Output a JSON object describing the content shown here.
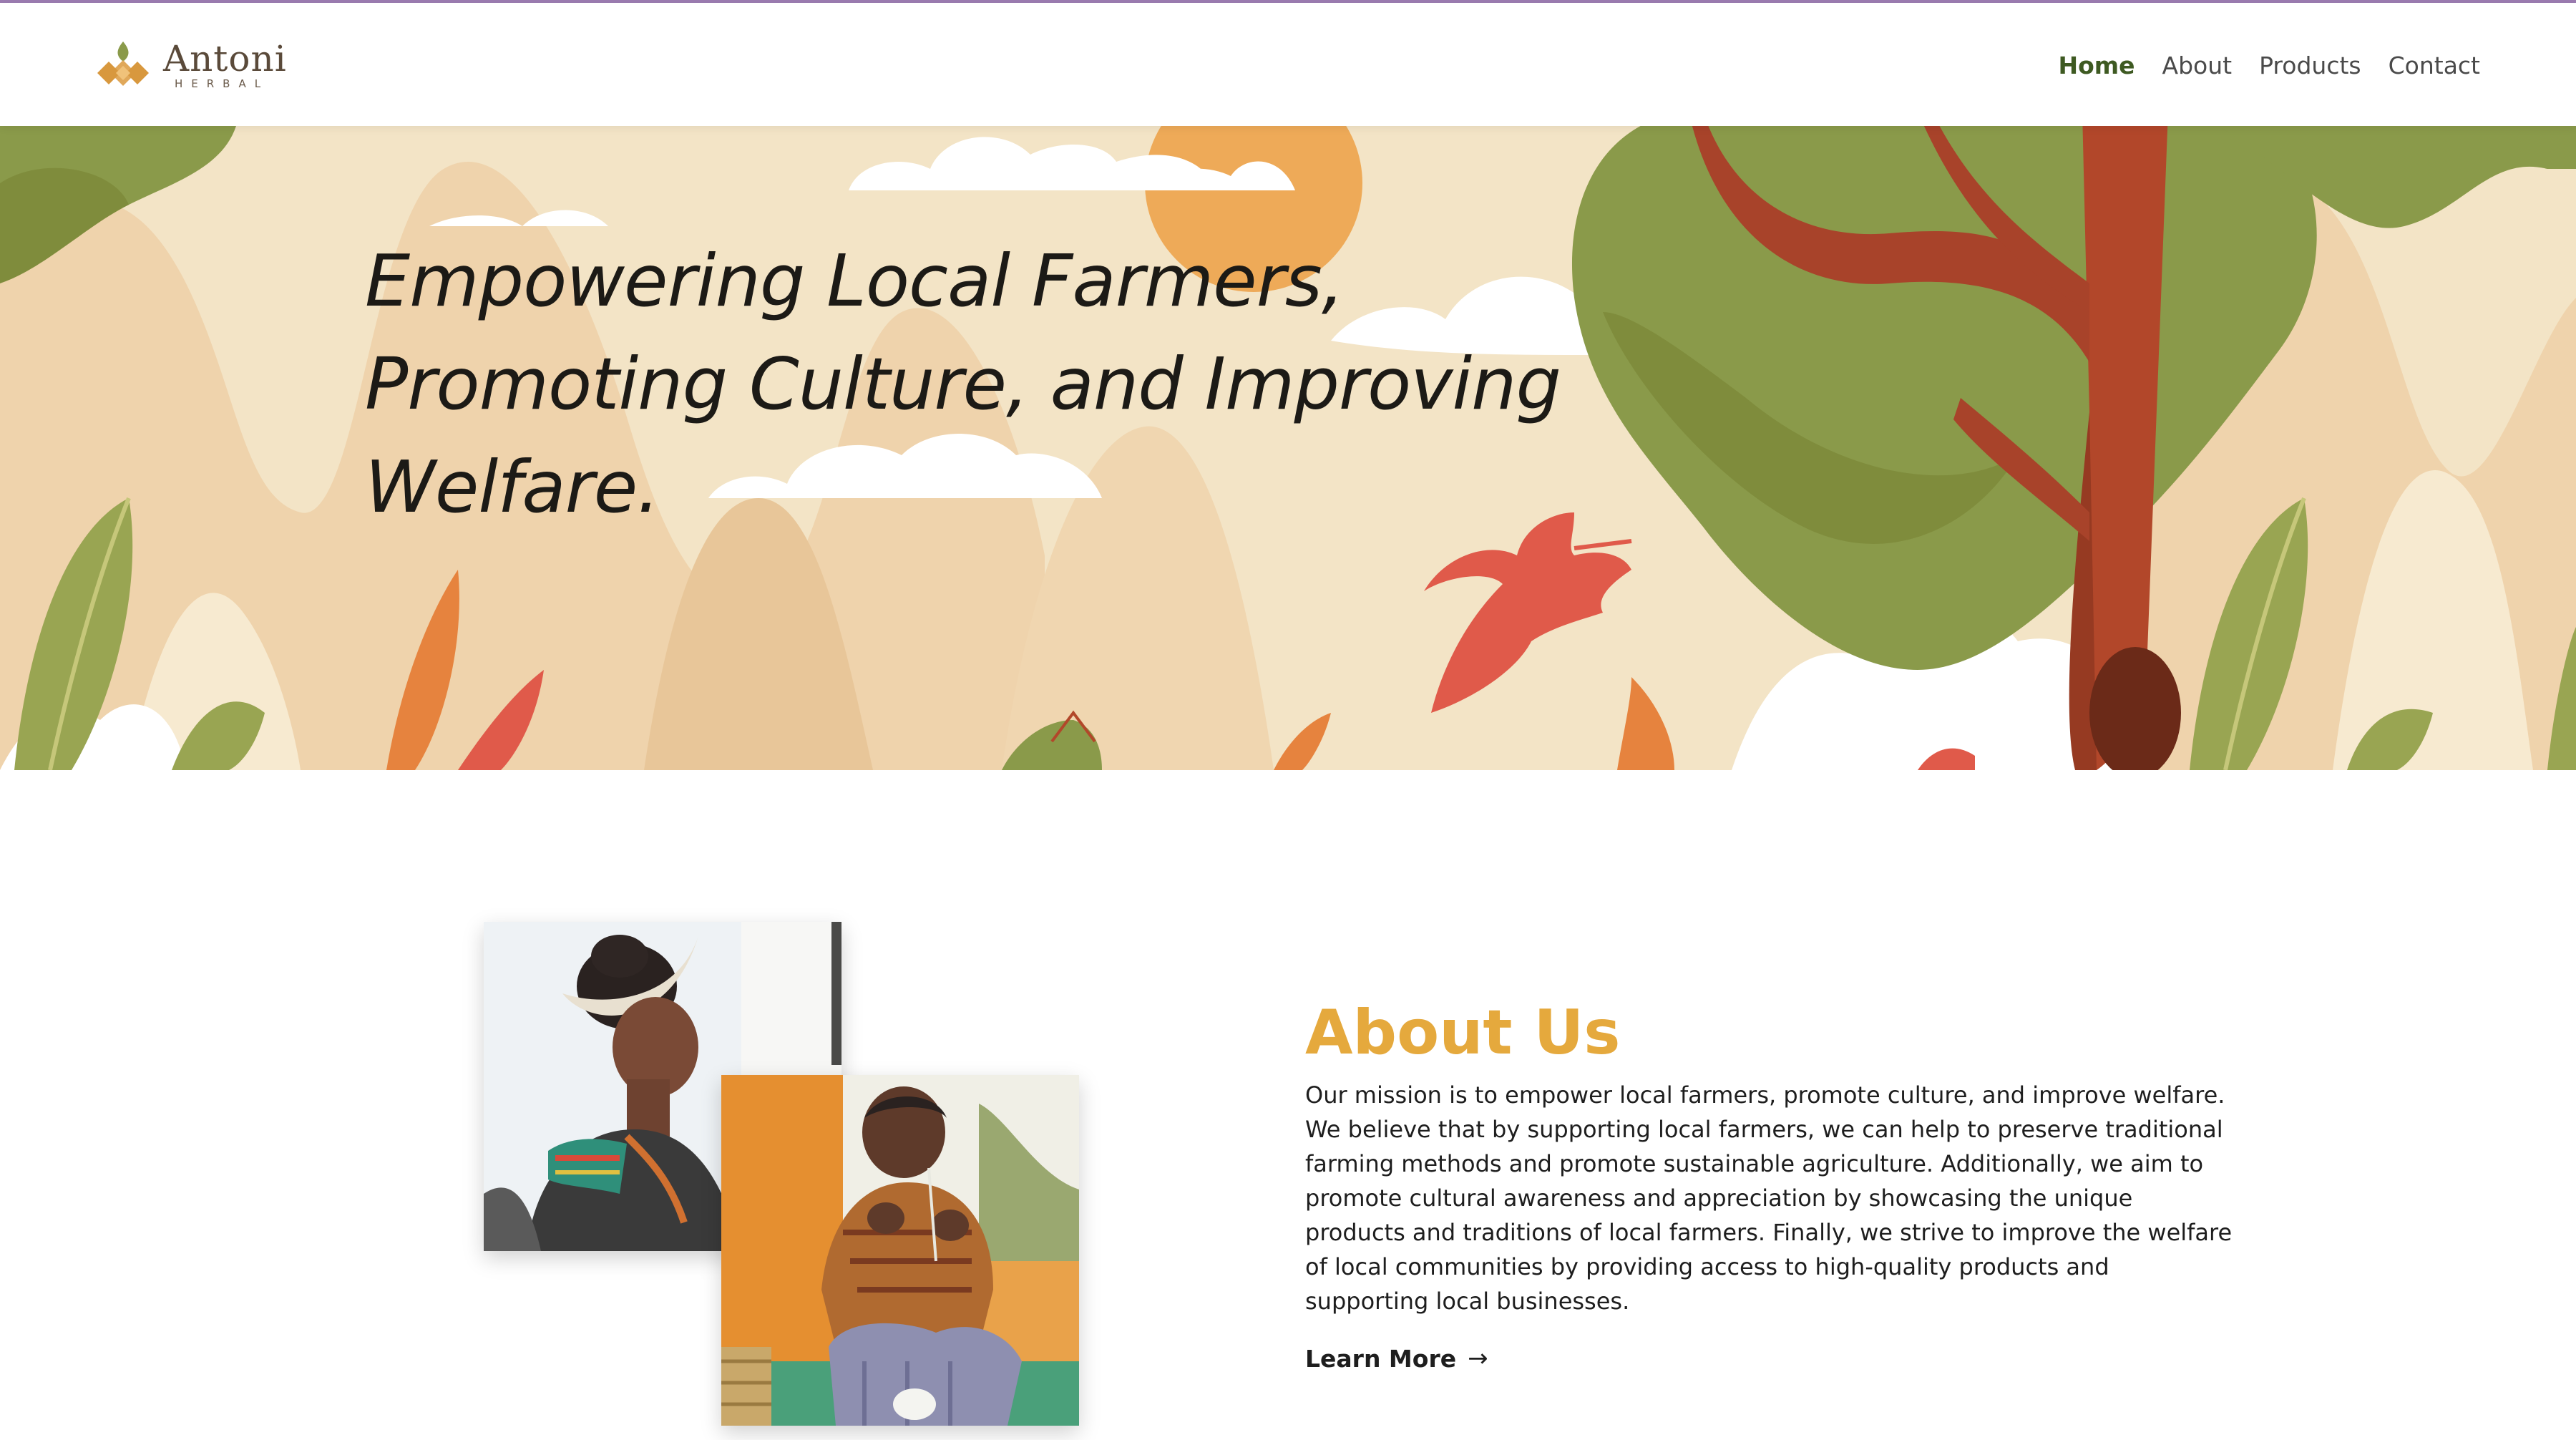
{
  "brand": {
    "name": "Antoni",
    "tagline": "HERBAL",
    "colors": {
      "leaf_green": "#8a9a4a",
      "diamond_orange": "#e0a85a",
      "accent_purple": "#9b7bb0"
    }
  },
  "nav": {
    "items": [
      {
        "label": "Home",
        "active": true
      },
      {
        "label": "About",
        "active": false
      },
      {
        "label": "Products",
        "active": false
      },
      {
        "label": "Contact",
        "active": false
      }
    ]
  },
  "hero": {
    "title": "Empowering Local Farmers, Promoting Culture, and Improving Welfare."
  },
  "about": {
    "heading": "About Us",
    "body": "Our mission is to empower local farmers, promote culture, and improve welfare. We believe that by supporting local farmers, we can help to preserve traditional farming methods and promote sustainable agriculture. Additionally, we aim to promote cultural awareness and appreciation by showcasing the unique products and traditions of local farmers. Finally, we strive to improve the welfare of local communities by providing access to high-quality products and supporting local businesses.",
    "cta_label": "Learn More",
    "cta_icon": "arrow-right-icon",
    "heading_color": "#e5a93d"
  }
}
